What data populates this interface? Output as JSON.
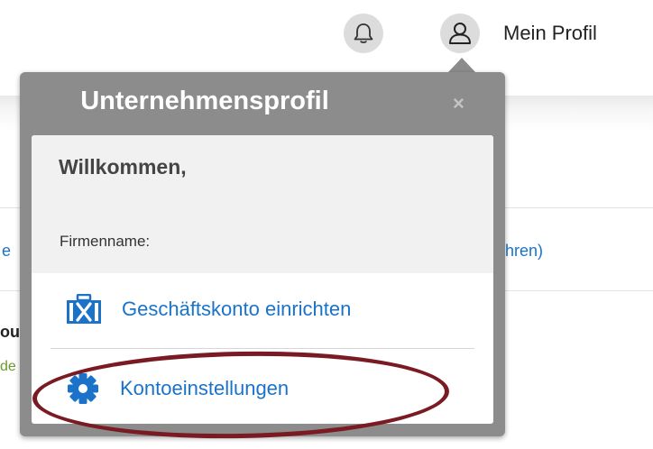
{
  "header": {
    "notifications_icon": "bell-icon",
    "profile_icon": "user-icon",
    "profile_label": "Mein Profil"
  },
  "background": {
    "fragment_left": "e",
    "fragment_right": "hren)",
    "fragment_dark": "ou",
    "fragment_green": "de"
  },
  "popup": {
    "title": "Unternehmensprofil",
    "close_label": "×",
    "welcome": "Willkommen,",
    "company_label": "Firmenname:",
    "items": [
      {
        "label": "Geschäftskonto einrichten",
        "icon": "toolbox-icon"
      },
      {
        "label": "Kontoeinstellungen",
        "icon": "gear-icon"
      }
    ]
  },
  "colors": {
    "link": "#1a73c9",
    "popup_bg": "#8c8c8c",
    "highlight": "#7a1a22"
  }
}
